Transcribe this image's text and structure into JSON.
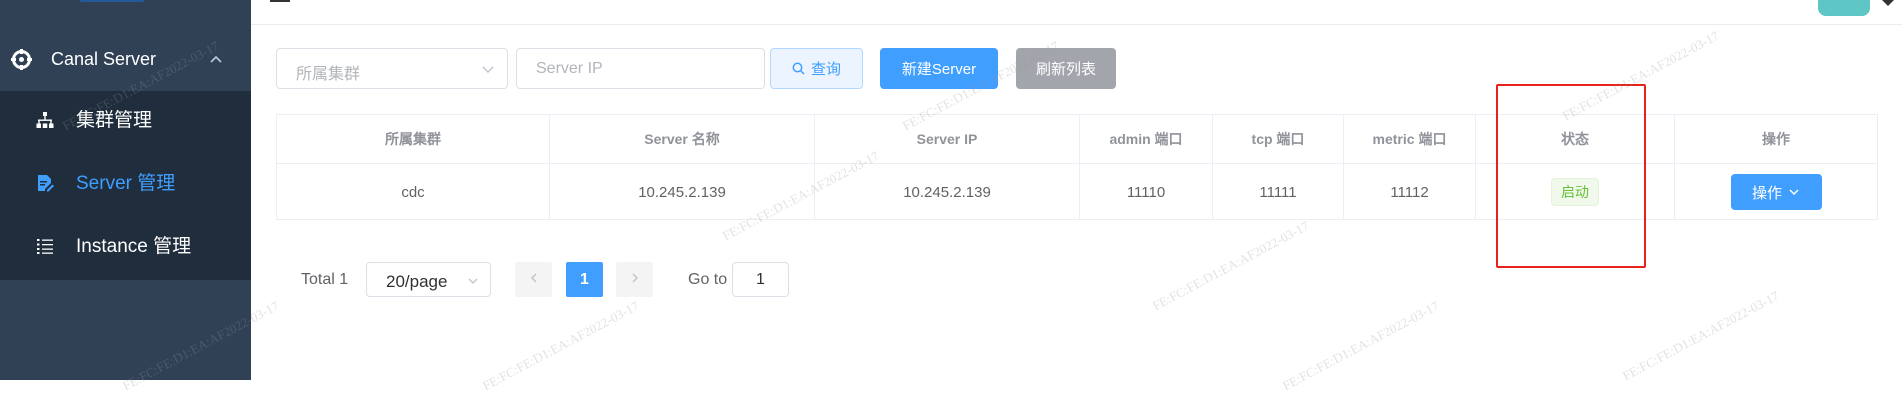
{
  "sidebar": {
    "group": {
      "label": "Canal Server",
      "icon": "cog-icon",
      "expanded": true
    },
    "items": [
      {
        "label": "集群管理",
        "icon": "sitemap-icon",
        "active": false
      },
      {
        "label": "Server 管理",
        "icon": "file-edit-icon",
        "active": true
      },
      {
        "label": "Instance 管理",
        "icon": "list-icon",
        "active": false
      }
    ],
    "colors": {
      "background": "#304156",
      "submenu_background": "#1f2d3d",
      "active_text": "#409eff"
    }
  },
  "filters": {
    "cluster_placeholder": "所属集群",
    "ip_placeholder": "Server IP",
    "query_label": "查询",
    "new_label": "新建Server",
    "refresh_label": "刷新列表"
  },
  "table": {
    "headers": [
      "所属集群",
      "Server 名称",
      "Server IP",
      "admin 端口",
      "tcp 端口",
      "metric 端口",
      "状态",
      "操作"
    ],
    "rows": [
      {
        "cluster": "cdc",
        "name": "10.245.2.139",
        "ip": "10.245.2.139",
        "admin_port": "11110",
        "tcp_port": "11111",
        "metric_port": "11112",
        "status": "启动",
        "action": "操作"
      }
    ]
  },
  "pagination": {
    "total": "Total 1",
    "page_size": "20/page",
    "current_page": "1",
    "goto_label": "Go to",
    "goto_value": "1"
  },
  "watermark": {
    "text": "FE:FC:FE:D1:EA:AF2022-03-17"
  },
  "colors": {
    "primary": "#409eff",
    "success": "#67c23a",
    "highlight": "#e8221a",
    "refresh_button": "#a2a5ab"
  }
}
